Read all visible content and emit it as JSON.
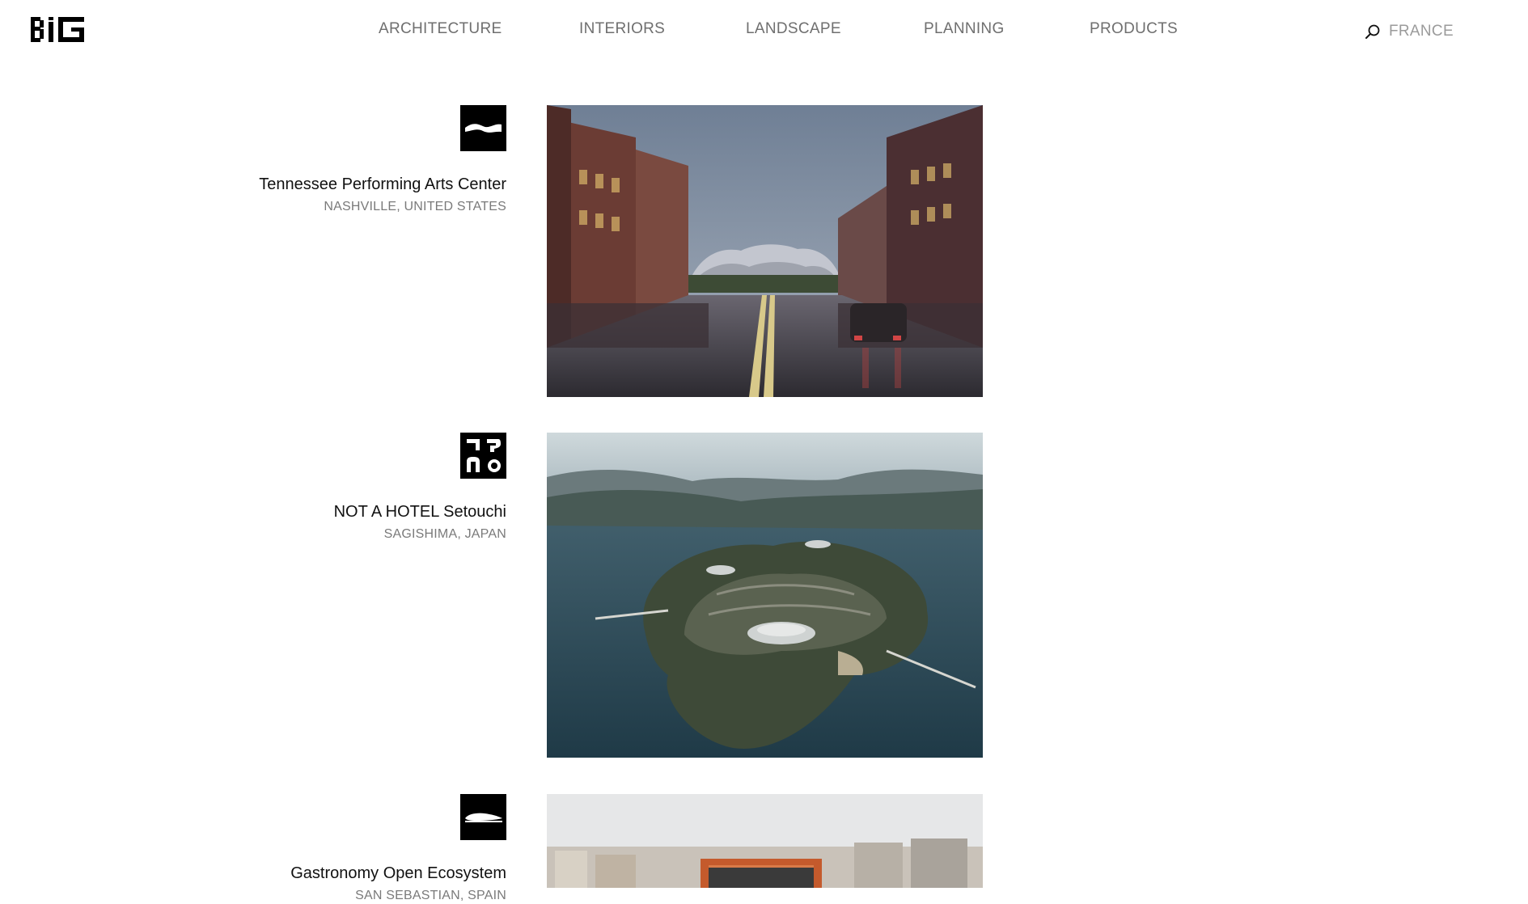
{
  "header": {
    "logo_text": "BIG",
    "nav": [
      {
        "label": "ARCHITECTURE"
      },
      {
        "label": "INTERIORS"
      },
      {
        "label": "LANDSCAPE"
      },
      {
        "label": "PLANNING"
      },
      {
        "label": "PRODUCTS"
      }
    ],
    "search": {
      "value": "FRANCE",
      "icon": "search-icon"
    }
  },
  "projects": [
    {
      "title": "Tennessee Performing Arts Center",
      "location": "NASHVILLE, UNITED STATES",
      "icon": "wave-pictogram-icon",
      "image": "street-rendering-photo"
    },
    {
      "title": "NOT A HOTEL Setouchi",
      "location": "SAGISHIMA, JAPAN",
      "icon": "not-a-hotel-glyph-icon",
      "image": "island-aerial-photo"
    },
    {
      "title": "Gastronomy Open Ecosystem",
      "location": "SAN SEBASTIAN, SPAIN",
      "icon": "boat-pictogram-icon",
      "image": "city-building-photo"
    }
  ],
  "colors": {
    "nav_text": "#6f6f6f",
    "location_text": "#7a7a7a",
    "title_text": "#111111",
    "icon_bg": "#000000"
  }
}
